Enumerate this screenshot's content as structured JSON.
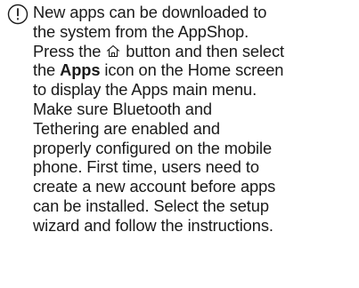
{
  "note": {
    "icon": "info-circle-icon",
    "lines": {
      "l1": "New apps can be downloaded to",
      "l2": "the system from the AppShop.",
      "l3_before": "Press the",
      "home_icon": "home-icon",
      "l3_after": "button and then select",
      "l4_before": "the",
      "l4_bold": "Apps",
      "l4_after": "icon on the Home screen",
      "l5": "to display the Apps main menu.",
      "l6": "Make sure Bluetooth and",
      "l7": "Tethering are enabled and",
      "l8": "properly configured on the mobile",
      "l9": "phone. First time, users need to",
      "l10": "create a new account before apps",
      "l11": "can be installed. Select the setup",
      "l12": "wizard and follow the instructions."
    }
  }
}
